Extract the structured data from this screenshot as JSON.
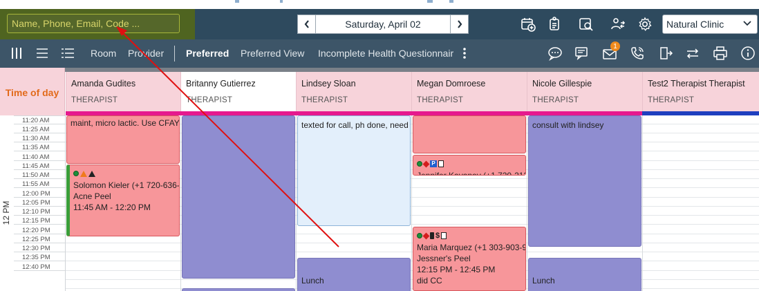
{
  "header": {
    "search_placeholder": "Name, Phone, Email, Code ...",
    "date": "Saturday, April 02",
    "clinic": "Natural Clinic"
  },
  "toolbar": {
    "room": "Room",
    "provider": "Provider",
    "preferred": "Preferred",
    "preferred_view": "Preferred View",
    "incomplete": "Incomplete Health Questionnair",
    "notifications_count": "1"
  },
  "schedule": {
    "time_head": "Time of day",
    "hour_label": "12 PM",
    "slots": [
      "11:20 AM",
      "11:25 AM",
      "11:30 AM",
      "11:35 AM",
      "11:40 AM",
      "11:45 AM",
      "11:50 AM",
      "11:55 AM",
      "12:00 PM",
      "12:05 PM",
      "12:10 PM",
      "12:15 PM",
      "12:20 PM",
      "12:25 PM",
      "12:30 PM",
      "12:35 PM",
      "12:40 PM"
    ],
    "providers": [
      {
        "name": "Amanda Gudites",
        "role": "THERAPIST"
      },
      {
        "name": "Britanny Gutierrez",
        "role": "THERAPIST"
      },
      {
        "name": "Lindsey Sloan",
        "role": "THERAPIST"
      },
      {
        "name": "Megan Domroese",
        "role": "THERAPIST"
      },
      {
        "name": "Nicole Gillespie",
        "role": "THERAPIST"
      },
      {
        "name": "Test2 Therapist Therapist",
        "role": "THERAPIST"
      }
    ],
    "appointments": {
      "amanda_note": "maint, micro lactic. Use CFAY?",
      "amanda_solomon_name": "Solomon Kieler (+1 720-636-",
      "amanda_solomon_service": "Acne Peel",
      "amanda_solomon_time": "11:45 AM - 12:20 PM",
      "lindsey_note": "texted for call, ph done, need h",
      "lindsey_lunch": "Lunch",
      "megan_jennifer": "Jennifer Kavanov (+1 720-213",
      "megan_maria_name": "Maria Marquez (+1 303-903-9",
      "megan_maria_service": "Jessner's Peel",
      "megan_maria_time": "12:15 PM - 12:45 PM",
      "megan_maria_note": "did CC",
      "nicole_note": "consult with lindsey",
      "nicole_lunch": "Lunch"
    }
  }
}
